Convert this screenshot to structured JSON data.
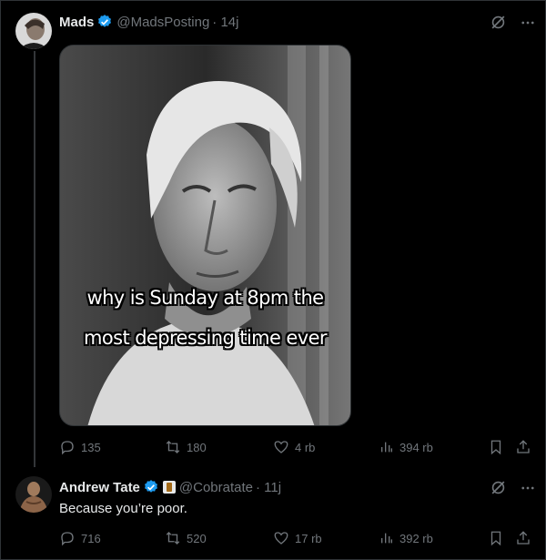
{
  "tweet1": {
    "name": "Mads",
    "handle": "@MadsPosting",
    "time": "· 14j",
    "meme_line1": "why is Sunday at 8pm the",
    "meme_line2": "most depressing time ever",
    "replies": "135",
    "retweets": "180",
    "likes": "4 rb",
    "views": "394 rb"
  },
  "tweet2": {
    "name": "Andrew Tate",
    "handle": "@Cobratate",
    "time": "· 11j",
    "text": "Because you’re poor.",
    "replies": "716",
    "retweets": "520",
    "likes": "17 rb",
    "views": "392 rb"
  },
  "colors": {
    "accent": "#1d9bf0",
    "muted": "#71767b",
    "text": "#e7e9ea",
    "bg": "#000000"
  },
  "icons": [
    "grok-icon",
    "more-icon",
    "reply-icon",
    "retweet-icon",
    "like-icon",
    "views-icon",
    "bookmark-icon",
    "share-icon",
    "verified-icon"
  ]
}
